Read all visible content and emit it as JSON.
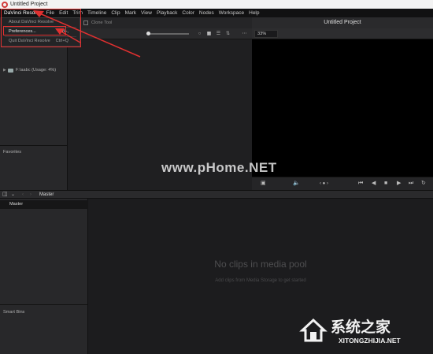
{
  "window": {
    "title": "Untitled Project"
  },
  "menubar": {
    "items": [
      "DaVinci Resolve",
      "File",
      "Edit",
      "Trim",
      "Timeline",
      "Clip",
      "Mark",
      "View",
      "Playback",
      "Color",
      "Nodes",
      "Workspace",
      "Help"
    ]
  },
  "app_menu": {
    "about": "About DaVinci Resolve",
    "preferences": "Preferences...",
    "preferences_shortcut": "Ctrl+,",
    "quit": "Quit DaVinci Resolve",
    "quit_shortcut": "Ctrl+Q"
  },
  "media_storage": {
    "drive_label": "F:\\aabc (Usage: 4%)",
    "favorites_label": "Favorites",
    "clone_tool_label": "Clone Tool"
  },
  "viewer": {
    "project_title": "Untitled Project",
    "zoom_value": "33%"
  },
  "media_pool": {
    "bar_title": "Master",
    "bin_master": "Master",
    "smart_bins_label": "Smart Bins",
    "empty_title": "No clips in media pool",
    "empty_subtitle": "Add clips from Media Storage to get started"
  },
  "watermarks": {
    "site_text": "www.pHome.NET",
    "brand_cn": "系统之家",
    "brand_url": "XITONGZHIJIA.NET"
  },
  "colors": {
    "highlight": "#e03030",
    "logo": "#d23b3b"
  }
}
